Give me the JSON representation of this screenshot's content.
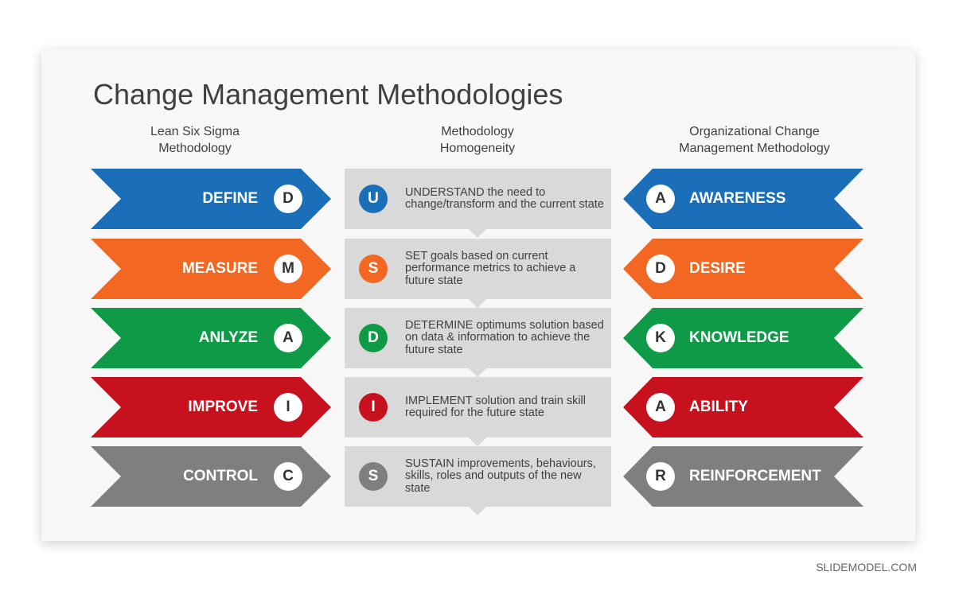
{
  "title": "Change Management Methodologies",
  "columns": {
    "left": [
      "Lean Six Sigma",
      "Methodology"
    ],
    "center": [
      "Methodology",
      "Homogeneity"
    ],
    "right": [
      "Organizational  Change",
      "Management  Methodology"
    ]
  },
  "rows": [
    {
      "color": "#1b6fb8",
      "left_label": "DEFINE",
      "left_letter": "D",
      "center_letter": "U",
      "center_text": "UNDERSTAND the need to change/transform and the current state",
      "right_letter": "A",
      "right_label": "AWARENESS"
    },
    {
      "color": "#f26722",
      "left_label": "MEASURE",
      "left_letter": "M",
      "center_letter": "S",
      "center_text": "SET goals based on current performance metrics to achieve a  future state",
      "right_letter": "D",
      "right_label": "DESIRE"
    },
    {
      "color": "#0f9a47",
      "left_label": "ANLYZE",
      "left_letter": "A",
      "center_letter": "D",
      "center_text": "DETERMINE optimums solution based on data & information to achieve the future state",
      "right_letter": "K",
      "right_label": "KNOWLEDGE"
    },
    {
      "color": "#c8111e",
      "left_label": "IMPROVE",
      "left_letter": "I",
      "center_letter": "I",
      "center_text": "IMPLEMENT solution and train skill required for the future state",
      "right_letter": "A",
      "right_label": "ABILITY"
    },
    {
      "color": "#7f7f7f",
      "left_label": "CONTROL",
      "left_letter": "C",
      "center_letter": "S",
      "center_text": "SUSTAIN improvements, behaviours, skills, roles and outputs of the new state",
      "right_letter": "R",
      "right_label": "REINFORCEMENT"
    }
  ],
  "brand": "SLIDEMODEL.COM"
}
